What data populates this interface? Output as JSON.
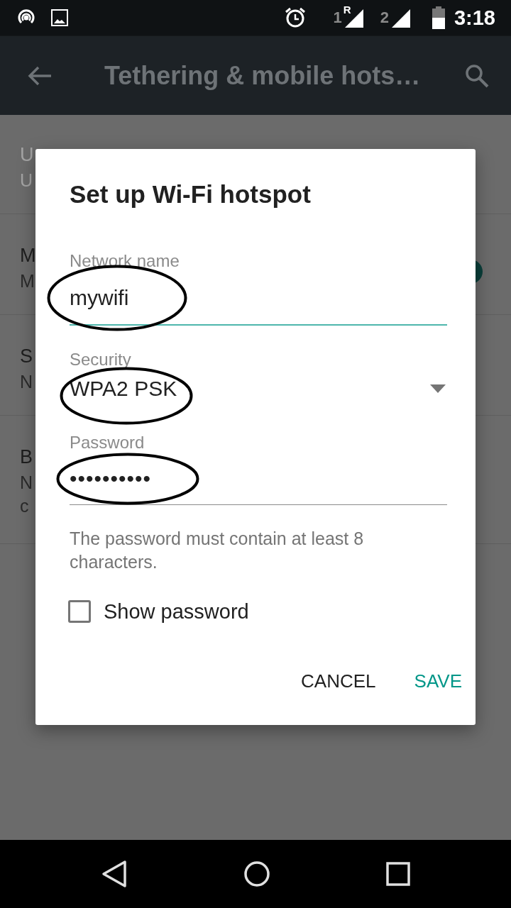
{
  "status_bar": {
    "sim_1": "1",
    "sim_1_roaming": "R",
    "sim_2": "2",
    "time": "3:18"
  },
  "app_bar": {
    "title": "Tethering & mobile hots…"
  },
  "settings_list": [
    {
      "title": "U",
      "subtitle": [
        "U"
      ],
      "disabled": true
    },
    {
      "title": "M",
      "subtitle": [
        "M"
      ],
      "disabled": false,
      "switch": {
        "on": true
      }
    },
    {
      "title": "S",
      "subtitle": [
        "N"
      ],
      "disabled": false
    },
    {
      "title": "B",
      "subtitle": [
        "N",
        "c"
      ],
      "disabled": false
    }
  ],
  "dialog": {
    "title": "Set up Wi-Fi hotspot",
    "fields": [
      {
        "kind": "text",
        "label": "Network name",
        "value": "mywifi",
        "focused": true,
        "circled": true
      },
      {
        "kind": "dropdown",
        "label": "Security",
        "value": "WPA2 PSK",
        "circled": true
      },
      {
        "kind": "password",
        "label": "Password",
        "value": "••••••••••",
        "focused": false,
        "circled": true
      }
    ],
    "helper_text": "The password must contain at least 8 characters.",
    "checkbox": {
      "label": "Show password",
      "checked": false
    },
    "buttons": [
      {
        "label": "CANCEL",
        "kind": "neutral"
      },
      {
        "label": "SAVE",
        "kind": "primary"
      }
    ]
  }
}
